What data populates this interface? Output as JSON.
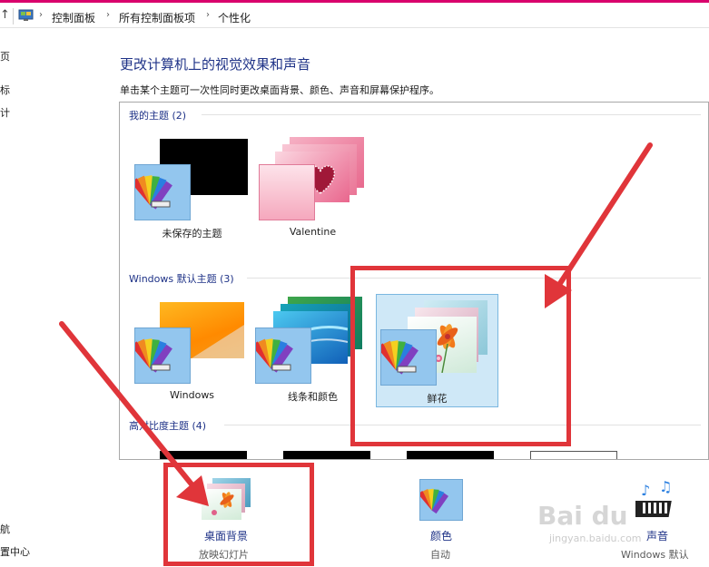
{
  "address": {
    "crumbs": [
      "控制面板",
      "所有控制面板项",
      "个性化"
    ]
  },
  "left_nav": {
    "items": [
      "页",
      "标",
      "计",
      "航",
      "置中心"
    ]
  },
  "page": {
    "title": "更改计算机上的视觉效果和声音",
    "description": "单击某个主题可一次性同时更改桌面背景、颜色、声音和屏幕保护程序。"
  },
  "themes": {
    "my_group": {
      "label": "我的主题 (2)"
    },
    "default_group": {
      "label": "Windows 默认主题 (3)"
    },
    "contrast_group": {
      "label": "高对比度主题 (4)"
    },
    "items": [
      {
        "label": "未保存的主题"
      },
      {
        "label": "Valentine"
      },
      {
        "label": "Windows"
      },
      {
        "label": "线条和颜色"
      },
      {
        "label": "鲜花"
      }
    ]
  },
  "bottom": {
    "background": {
      "label": "桌面背景",
      "sub": "放映幻灯片"
    },
    "color": {
      "label": "颜色",
      "sub": "自动"
    },
    "sound": {
      "label": "声音",
      "sub": "Windows 默认"
    }
  },
  "watermark": {
    "text": "Bai du",
    "sub": "jingyan.baidu.com"
  },
  "colors": {
    "accent_top": "#d9006c",
    "link_blue": "#1e3287",
    "selection": "#cfe8f7",
    "annotation_red": "#e0353a"
  }
}
